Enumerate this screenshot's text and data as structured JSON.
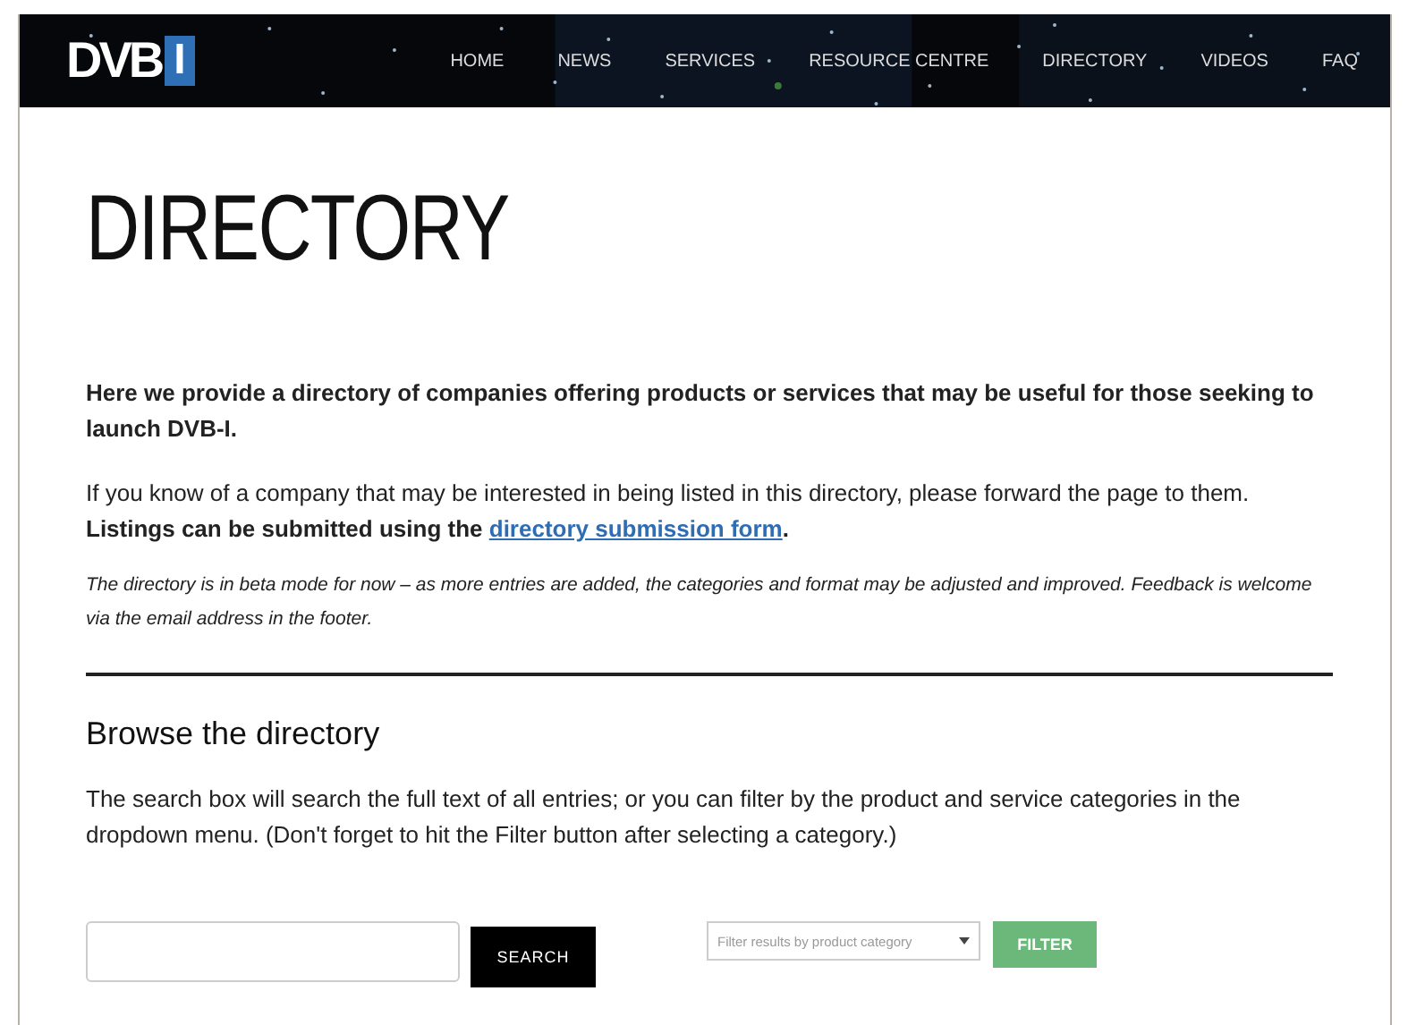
{
  "logo": {
    "text": "DVB",
    "accent": "I"
  },
  "nav": [
    {
      "label": "HOME"
    },
    {
      "label": "NEWS"
    },
    {
      "label": "SERVICES"
    },
    {
      "label": "RESOURCE CENTRE"
    },
    {
      "label": "DIRECTORY"
    },
    {
      "label": "VIDEOS"
    },
    {
      "label": "FAQ"
    }
  ],
  "title": "DIRECTORY",
  "intro": "Here we provide a directory of companies offering products or services that may be useful for those seeking to launch DVB-I.",
  "listing": {
    "text": "If you know of a company that may be interested in being listed in this directory, please forward the page to them. **Listings can be submitted using the**",
    "link": "directory submission form",
    "after": "."
  },
  "note": "The directory is in beta mode for now – as more entries are added, the categories and format may be adjusted and improved. Feedback is welcome via the email address in the footer.",
  "browse": {
    "heading": "Browse the directory",
    "text": "The search box will search the full text of all entries; or you can filter by the product and service categories in the dropdown menu. (Don't forget to hit the Filter button after selecting a category.)"
  },
  "search": {
    "button": "SEARCH"
  },
  "filter": {
    "placeholder": "Filter results by product category",
    "button": "FILTER"
  }
}
